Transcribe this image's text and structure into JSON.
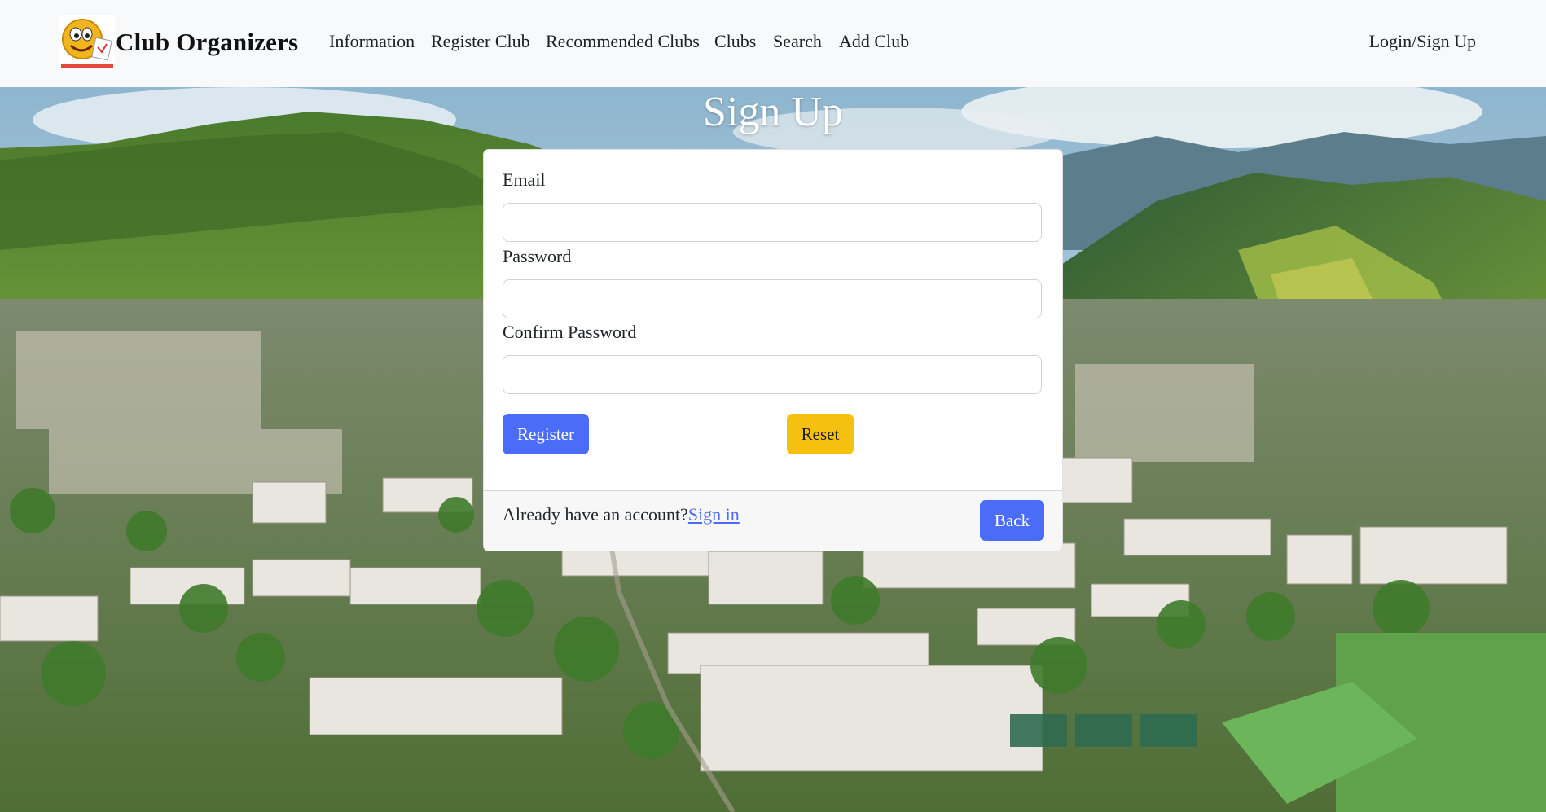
{
  "navbar": {
    "brand": "Club Organizers",
    "links": [
      "Information",
      "Register Club",
      "Recommended Clubs",
      "Clubs",
      "Search",
      "Add Club"
    ],
    "login": "Login/Sign Up"
  },
  "page": {
    "title": "Sign Up"
  },
  "form": {
    "email_label": "Email",
    "email_value": "",
    "password_label": "Password",
    "password_value": "",
    "confirm_label": "Confirm Password",
    "confirm_value": "",
    "register_button": "Register",
    "reset_button": "Reset"
  },
  "footer": {
    "prompt": "Already have an account?",
    "signin_link": "Sign in",
    "back_button": "Back"
  },
  "colors": {
    "navbar_bg": "#f8f9fa",
    "primary": "#4a6cf7",
    "warning": "#f5c110"
  },
  "icons": {
    "logo": "smiley-logo-icon"
  }
}
